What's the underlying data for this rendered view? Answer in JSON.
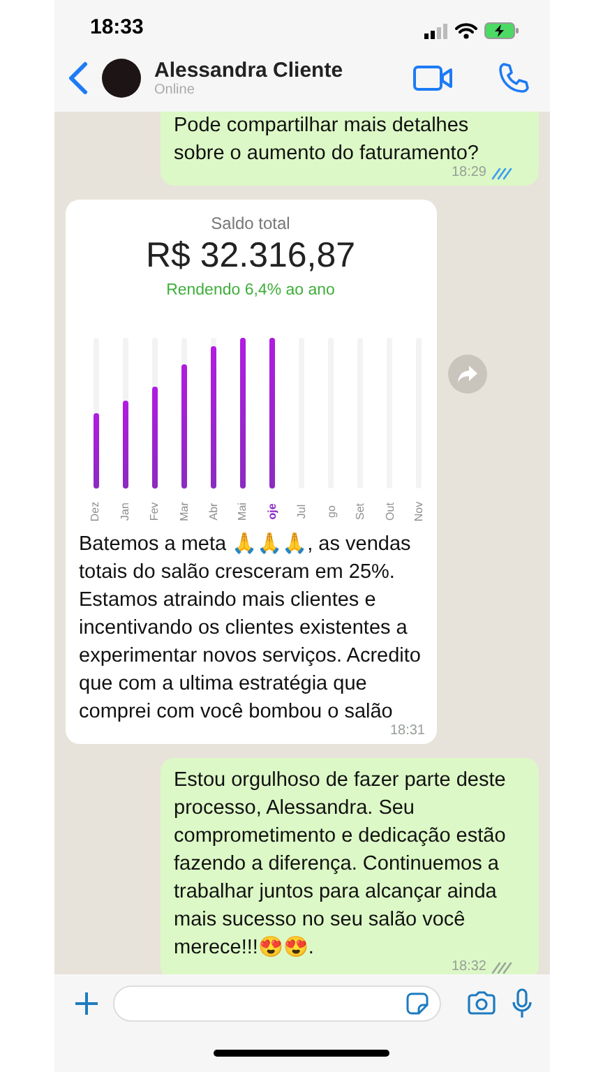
{
  "status_bar": {
    "time": "18:33"
  },
  "header": {
    "name": "Alessandra Cliente",
    "status": "Online"
  },
  "messages": [
    {
      "kind": "text",
      "outgoing": true,
      "text": "Pode compartilhar mais detalhes sobre o aumento do faturamento?",
      "time": "18:29",
      "read": true
    },
    {
      "kind": "image",
      "outgoing": false,
      "image": {
        "title": "Saldo total",
        "amount": "R$ 32.316,87",
        "yield": "Rendendo 6,4% ao ano",
        "months": [
          {
            "label": "Dez",
            "selected": false
          },
          {
            "label": "Jan",
            "selected": false
          },
          {
            "label": "Fev",
            "selected": false
          },
          {
            "label": "Mar",
            "selected": false
          },
          {
            "label": "Abr",
            "selected": false
          },
          {
            "label": "Mai",
            "selected": false
          },
          {
            "label": "oje",
            "selected": true
          },
          {
            "label": "Jul",
            "selected": false
          },
          {
            "label": "go",
            "selected": false
          },
          {
            "label": "Set",
            "selected": false
          },
          {
            "label": "Out",
            "selected": false
          },
          {
            "label": "Nov",
            "selected": false
          }
        ]
      },
      "text": "Batemos a meta 🙏🙏🙏, as vendas totais do salão cresceram em 25%. Estamos atraindo mais clientes e incentivando os clientes existentes a experimentar novos serviços. Acredito que com a ultima estratégia que comprei com você bombou o salão",
      "time": "18:31"
    },
    {
      "kind": "text",
      "outgoing": true,
      "text": "Estou orgulhoso de fazer parte deste processo, Alessandra. Seu comprometimento e dedicação estão fazendo a diferença. Continuemos a trabalhar juntos para alcançar ainda mais sucesso no seu salão você merece!!!😍😍.",
      "time": "18:32",
      "read": false
    }
  ]
}
